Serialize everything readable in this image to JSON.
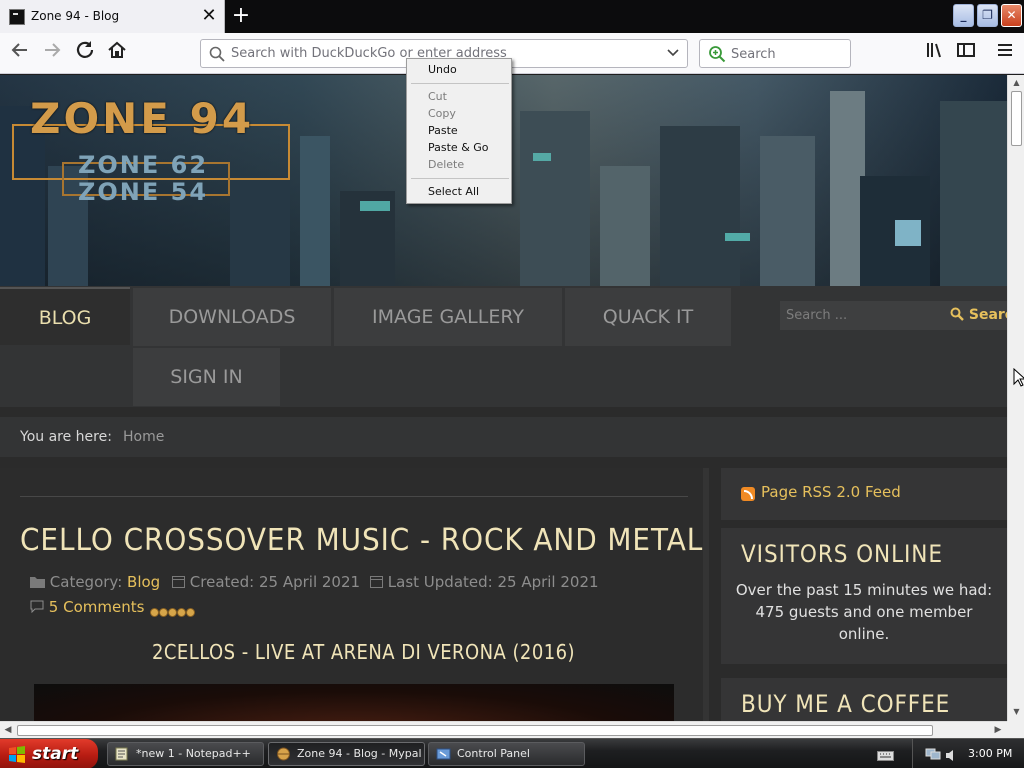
{
  "browser": {
    "tab_title": "Zone 94 - Blog",
    "tab_close": "✕",
    "new_tab": "+",
    "url_placeholder": "Search with DuckDuckGo or enter address",
    "search_placeholder": "Search"
  },
  "context_menu": {
    "items": [
      "Undo",
      "Cut",
      "Copy",
      "Paste",
      "Paste & Go",
      "Delete",
      "Select All"
    ]
  },
  "site": {
    "logo": {
      "main": "ZONE 94",
      "sub1": "ZONE 62",
      "sub2": "ZONE 54"
    },
    "menu": [
      "BLOG",
      "DOWNLOADS",
      "IMAGE GALLERY",
      "QUACK IT",
      "SIGN IN"
    ],
    "search_placeholder": "Search ...",
    "search_button": "Search",
    "breadcrumb": {
      "label": "You are here:",
      "home": "Home"
    },
    "article": {
      "title": "CELLO CROSSOVER MUSIC - ROCK AND METAL",
      "category_label": "Category:",
      "category": "Blog",
      "created": "Created: 25 April 2021",
      "updated": "Last Updated: 25 April 2021",
      "comments": "5 Comments",
      "rating_stars": 5,
      "subtitle": "2CELLOS - LIVE AT ARENA DI VERONA (2016)"
    },
    "sidebar": {
      "rss": "Page RSS 2.0 Feed",
      "visitors_title": "VISITORS ONLINE",
      "visitors_text": "Over the past 15 minutes we had: 475 guests and one member online.",
      "coffee_title": "BUY ME A COFFEE"
    }
  },
  "taskbar": {
    "start": "start",
    "tasks": [
      "*new 1 - Notepad++",
      "Zone 94 - Blog - Mypal",
      "Control Panel"
    ],
    "clock": "3:00 PM"
  },
  "colors": {
    "accent": "#e6c05c",
    "heading": "#f0e4b8",
    "page_bg": "#2b2b2b"
  }
}
